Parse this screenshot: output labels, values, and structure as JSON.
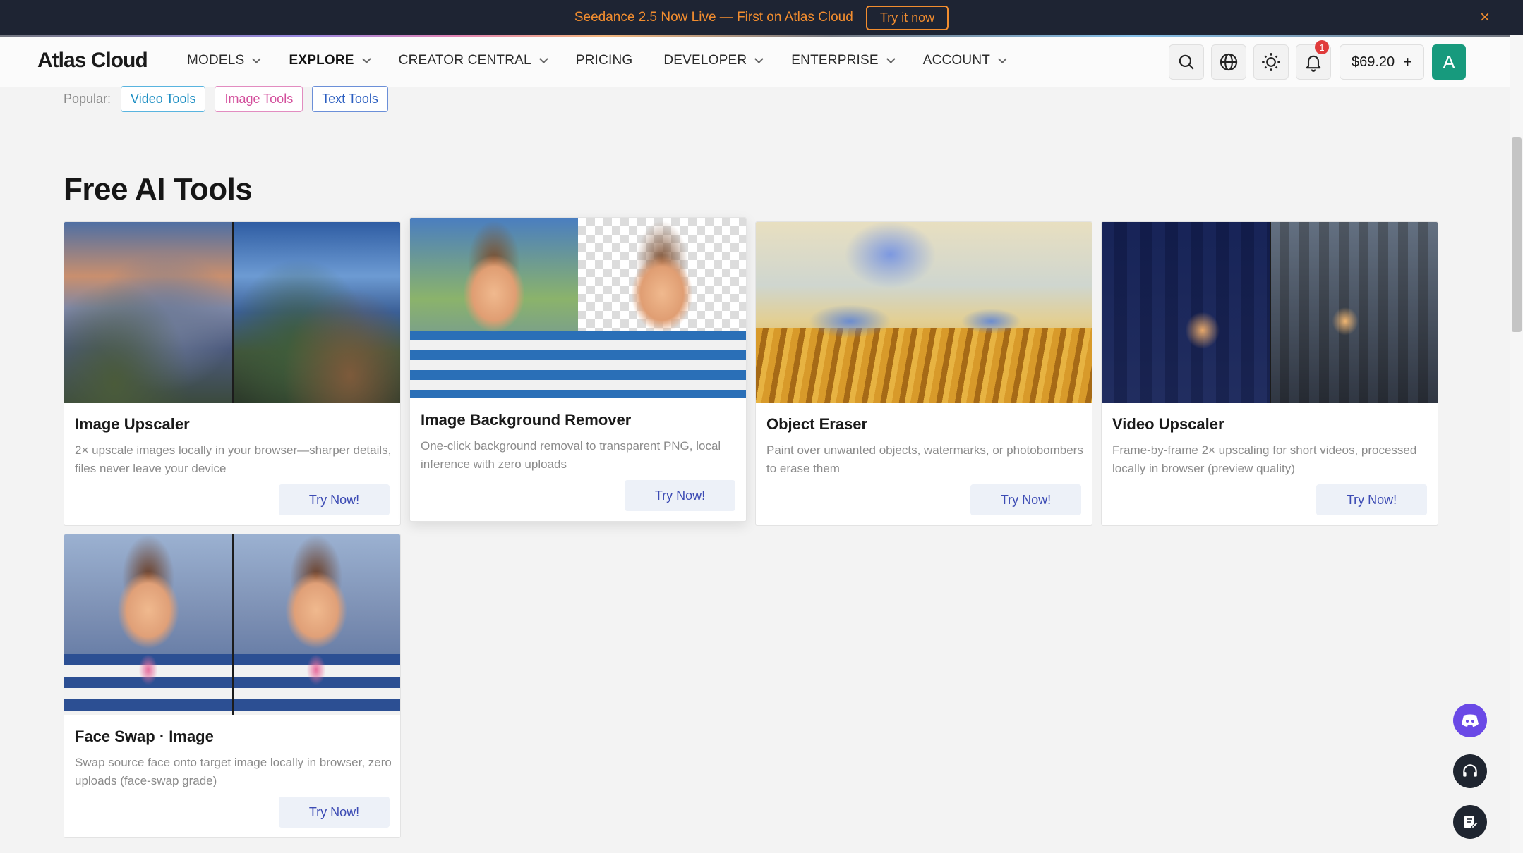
{
  "announcement": {
    "text": "Seedance 2.5 Now Live — First on Atlas Cloud",
    "button": "Try it now",
    "close_label": "×"
  },
  "nav": {
    "logo": "Atlas Cloud",
    "menu": [
      {
        "label": "MODELS",
        "dropdown": true
      },
      {
        "label": "EXPLORE",
        "dropdown": true,
        "active": true
      },
      {
        "label": "CREATOR CENTRAL",
        "dropdown": true
      },
      {
        "label": "PRICING",
        "dropdown": false
      },
      {
        "label": "DEVELOPER",
        "dropdown": true
      },
      {
        "label": "ENTERPRISE",
        "dropdown": true
      },
      {
        "label": "ACCOUNT",
        "dropdown": true
      }
    ],
    "notification_count": "1",
    "balance": "$69.20",
    "balance_plus": "+",
    "avatar_initial": "A"
  },
  "popular": {
    "label": "Popular:",
    "chips": [
      "Video Tools",
      "Image Tools",
      "Text Tools"
    ]
  },
  "section_title": "Free AI Tools",
  "cards": [
    {
      "title": "Image Upscaler",
      "desc": "2× upscale images locally in your browser—sharper details, files never leave your device",
      "button": "Try Now!",
      "image": "landscape-before-after"
    },
    {
      "title": "Image Background Remover",
      "desc": "One-click background removal to transparent PNG, local inference with zero uploads",
      "button": "Try Now!",
      "image": "boy-icecream-bg-removed"
    },
    {
      "title": "Object Eraser",
      "desc": "Paint over unwanted objects, watermarks, or photobombers to erase them",
      "button": "Try Now!",
      "image": "girls-in-field"
    },
    {
      "title": "Video Upscaler",
      "desc": "Frame-by-frame 2× upscaling for short videos, processed locally in browser (preview quality)",
      "button": "Try Now!",
      "image": "city-street-before-after"
    },
    {
      "title": "Face Swap · Image",
      "desc": "Swap source face onto target image locally in browser, zero uploads (face-swap grade)",
      "button": "Try Now!",
      "image": "boy-faceswap"
    }
  ],
  "colors": {
    "announcement_bg": "#1e2433",
    "announcement_accent": "#f28d2f",
    "try_now_text": "#3c4bb4",
    "avatar_bg": "#179a7d",
    "discord": "#6a49e6"
  },
  "icons": [
    "search-icon",
    "globe-icon",
    "sun-icon",
    "bell-icon",
    "discord-icon",
    "headset-icon",
    "feedback-icon",
    "close-icon",
    "chevron-down-icon"
  ]
}
